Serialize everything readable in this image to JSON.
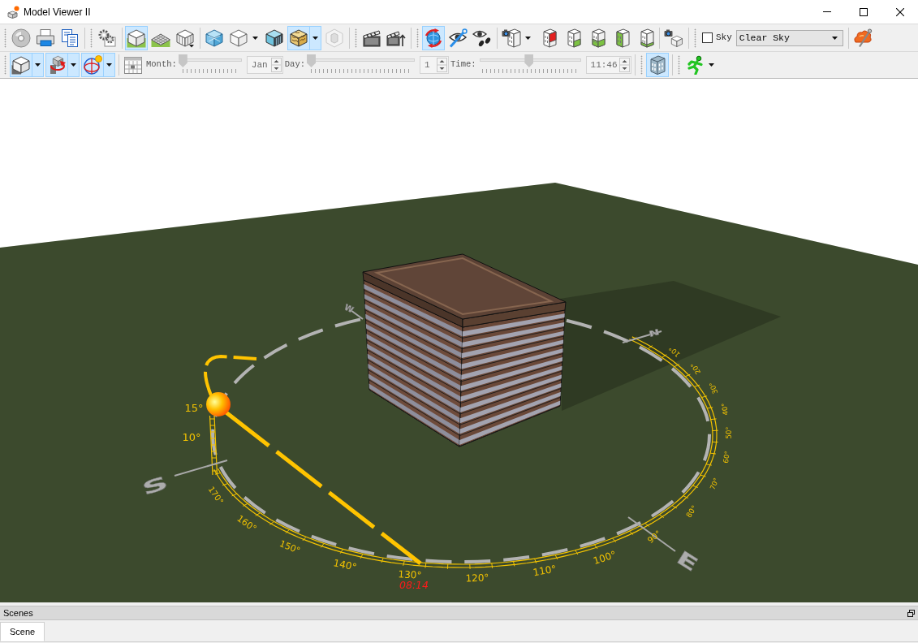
{
  "window": {
    "title": "Model Viewer II"
  },
  "toolbar_1": {
    "groups": [
      {
        "buttons": [
          {
            "selected": false,
            "dropdown": false,
            "disabled": false
          },
          {
            "selected": false,
            "dropdown": false,
            "disabled": false
          },
          {
            "selected": false,
            "dropdown": false,
            "disabled": false
          }
        ]
      },
      {
        "buttons": [
          {
            "selected": false,
            "dropdown": false,
            "disabled": false
          }
        ]
      },
      {
        "buttons": [
          {
            "selected": true,
            "dropdown": false,
            "disabled": false
          },
          {
            "selected": false,
            "dropdown": false,
            "disabled": false
          },
          {
            "selected": false,
            "dropdown": false,
            "disabled": false
          }
        ]
      },
      {
        "buttons": [
          {
            "selected": false,
            "dropdown": false,
            "disabled": false
          },
          {
            "selected": false,
            "dropdown": true,
            "disabled": false
          },
          {
            "selected": false,
            "dropdown": false,
            "disabled": false
          },
          {
            "selected": true,
            "dropdown": true,
            "disabled": false
          },
          {
            "selected": false,
            "dropdown": false,
            "disabled": true
          }
        ]
      },
      {
        "buttons": [
          {
            "selected": false,
            "dropdown": false,
            "disabled": false
          },
          {
            "selected": false,
            "dropdown": false,
            "disabled": false
          }
        ]
      },
      {
        "buttons": [
          {
            "selected": true,
            "dropdown": false,
            "disabled": false
          },
          {
            "selected": false,
            "dropdown": false,
            "disabled": false
          },
          {
            "selected": false,
            "dropdown": false,
            "disabled": false
          }
        ]
      },
      {
        "buttons": [
          {
            "selected": false,
            "dropdown": true,
            "disabled": false
          },
          {
            "selected": false,
            "dropdown": false,
            "disabled": false
          },
          {
            "selected": false,
            "dropdown": false,
            "disabled": false
          },
          {
            "selected": false,
            "dropdown": false,
            "disabled": false
          },
          {
            "selected": false,
            "dropdown": false,
            "disabled": false
          },
          {
            "selected": false,
            "dropdown": false,
            "disabled": false
          }
        ]
      },
      {
        "buttons": [
          {
            "selected": false,
            "dropdown": false,
            "disabled": false
          }
        ]
      }
    ],
    "sky_checkbox": {
      "label": "Sky",
      "checked": false
    },
    "sky_dropdown": {
      "value": "Clear Sky"
    },
    "end_buttons": [
      {
        "selected": false,
        "dropdown": false,
        "disabled": false
      }
    ]
  },
  "toolbar_2": {
    "view_buttons": [
      {
        "selected": true,
        "dropdown": true,
        "disabled": false
      },
      {
        "selected": true,
        "dropdown": true,
        "disabled": false
      },
      {
        "selected": true,
        "dropdown": true,
        "disabled": false
      }
    ],
    "calendar_button": {
      "selected": false,
      "dropdown": false,
      "disabled": false
    },
    "sliders": [
      {
        "label": "Month:",
        "level": 0,
        "value": "Jan"
      },
      {
        "label": "Day:",
        "level": 0,
        "value": "1"
      },
      {
        "label": "Time:",
        "level": 0.49,
        "value": "11:46"
      }
    ],
    "building_button": {
      "selected": true,
      "dropdown": false,
      "disabled": false
    },
    "walk_button": {
      "selected": false,
      "dropdown": true,
      "disabled": false
    }
  },
  "viewport": {
    "compass": [
      {
        "label": "W"
      },
      {
        "label": "N"
      },
      {
        "label": "S"
      },
      {
        "label": "E"
      }
    ],
    "altitude_labels": [
      "15°",
      "10°"
    ],
    "azimuth_labels": [
      "170°",
      "160°",
      "150°",
      "140°",
      "130°",
      "120°",
      "110°",
      "100°",
      "90°",
      "80°",
      "70°",
      "60°",
      "50°",
      "40°",
      "30°",
      "20°",
      "10°"
    ],
    "time_labels": [
      "08:14"
    ]
  },
  "scenes_panel": {
    "title": "Scenes",
    "tabs": [
      {
        "label": "Scene",
        "selected": true
      }
    ]
  }
}
